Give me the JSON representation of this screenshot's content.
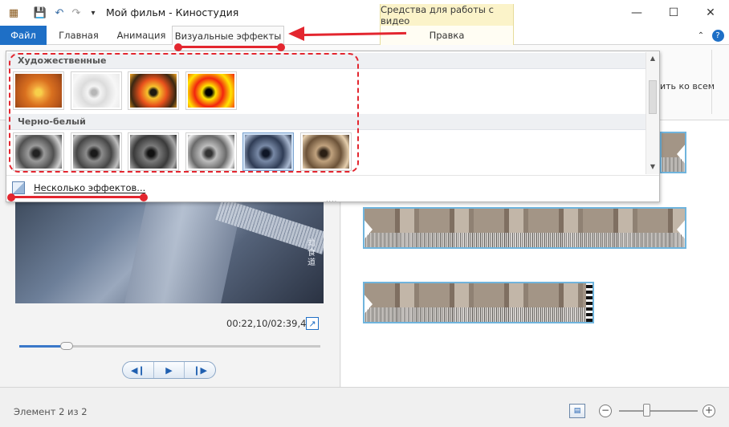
{
  "window": {
    "title": "Мой фильм - Киностудия",
    "contextual_tab_group": "Средства для работы с видео"
  },
  "ribbon": {
    "tabs": [
      {
        "label": "Файл"
      },
      {
        "label": "Главная"
      },
      {
        "label": "Анимация"
      },
      {
        "label": "Визуальные эффекты"
      },
      {
        "label": "Правка"
      }
    ],
    "apply_all_label": "ить ко всем"
  },
  "effects_gallery": {
    "groups": [
      {
        "label": "Художественные"
      },
      {
        "label": "Черно-белый"
      }
    ],
    "footer_label": "Несколько эффектов...",
    "grip": "....",
    "thumbs": {
      "artistic": [
        {
          "icon": "flower-warm-thumb",
          "gradient": "radial-gradient(circle at 50% 55%, #f7d04a 0 10%, #f0a23a 22%, #d9701f 45%, #b8561a 75%, #8a4214 100%)"
        },
        {
          "icon": "flower-sketch-thumb",
          "gradient": "radial-gradient(circle at 45% 55%, #b6b6b6 0 8%, #f4f4f4 20%, #dcdcdc 40%, #f7f7f7 70%, #e9e9e9 100%)"
        },
        {
          "icon": "flower-posterize-thumb",
          "gradient": "radial-gradient(circle at 50% 55%, #1e1a10 0 10%, #f6c22c 20%, #e8511c 45%, #3a2712 75%, #f5a623 100%)"
        },
        {
          "icon": "flower-threshold-thumb",
          "gradient": "radial-gradient(circle at 45% 55%, #000 0 10%, #ffe400 22%, #f2250f 45%, #ffe400 70%, #f2250f 100%)"
        }
      ],
      "bw": [
        {
          "icon": "flower-bw-1-thumb",
          "gradient": "radial-gradient(circle at 45% 55%, #222 0 10%, #9a9a9a 25%, #505050 55%, #d0d0d0 80%, #3a3a3a 100%)"
        },
        {
          "icon": "flower-bw-2-thumb",
          "gradient": "radial-gradient(circle at 45% 55%, #1a1a1a 0 10%, #8c8c8c 25%, #454545 55%, #c0c0c0 80%, #2c2c2c 100%)"
        },
        {
          "icon": "flower-bw-3-thumb",
          "gradient": "radial-gradient(circle at 45% 55%, #111 0 10%, #7a7a7a 25%, #3a3a3a 55%, #a8a8a8 80%, #262626 100%)"
        },
        {
          "icon": "flower-bw-4-thumb",
          "gradient": "radial-gradient(circle at 45% 55%, #333 0 10%, #bdbdbd 25%, #6a6a6a 55%, #ededed 80%, #4a4a4a 100%)"
        },
        {
          "icon": "flower-cyanotype-thumb",
          "gradient": "radial-gradient(circle at 45% 55%, #0e1626 0 10%, #7889a6 25%, #2f3c55 55%, #a9b8d0 80%, #1c273a 100%)"
        },
        {
          "icon": "flower-sepia-thumb",
          "gradient": "radial-gradient(circle at 45% 55%, #2a1f14 0 10%, #c0a27e 25%, #6b5238 55%, #e6cfae 80%, #4b3826 100%)"
        }
      ]
    }
  },
  "preview": {
    "timecode": "00:22,10/02:39,43",
    "watermark": "劫食道",
    "seek_fraction": 0.14
  },
  "statusbar": {
    "text": "Элемент 2 из 2",
    "zoom_fraction": 0.35
  },
  "colors": {
    "accent": "#1e6fc6",
    "annotation": "#e3262f",
    "clip_border": "#6fb4dd"
  }
}
